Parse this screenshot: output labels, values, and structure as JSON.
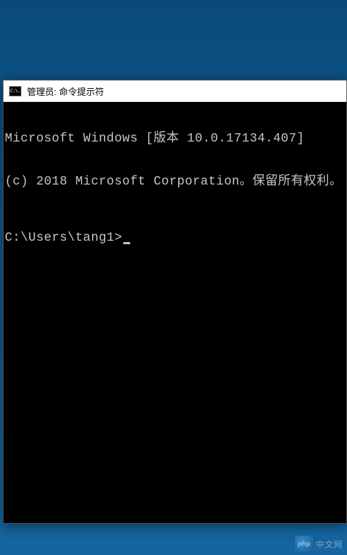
{
  "window": {
    "title": "管理员: 命令提示符",
    "icon_label": "C:\\."
  },
  "terminal": {
    "version_line": "Microsoft Windows [版本 10.0.17134.407]",
    "copyright_line": "(c) 2018 Microsoft Corporation。保留所有权利。",
    "prompt": "C:\\Users\\tang1>"
  },
  "watermark": {
    "badge": "php",
    "text": "中文网"
  }
}
